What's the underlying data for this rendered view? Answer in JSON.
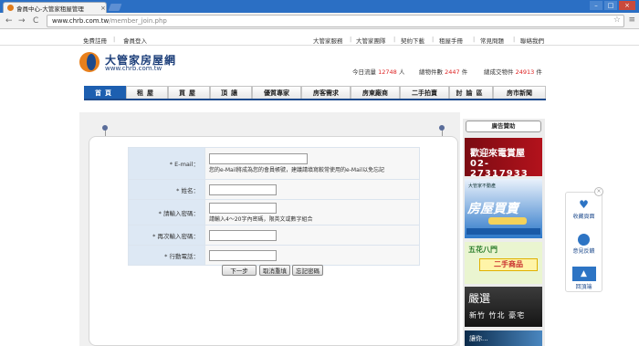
{
  "browser": {
    "tab_title": "會員中心-大管家租屋管理",
    "tab_close": "×",
    "url_host": "www.chrb.com.tw",
    "url_path": "/member_join.php",
    "back": "←",
    "forward": "→",
    "reload": "C",
    "star": "☆",
    "menu": "≡"
  },
  "top_links": {
    "left": [
      "免費註冊",
      "會員登入"
    ],
    "right": [
      "大管家服務",
      "大管家團隊",
      "契約下載",
      "租屋手冊",
      "常見問題",
      "聯絡我們"
    ]
  },
  "logo": {
    "name": "大管家房屋網",
    "url": "www.chrb.com.tw"
  },
  "stats": {
    "today_label": "今日流量",
    "today_value": "12748",
    "today_unit": "人",
    "delegated_label": "總物件數",
    "delegated_value": "2447",
    "delegated_unit": "件",
    "done_label": "總成交物件",
    "done_value": "24913",
    "done_unit": "件"
  },
  "main_nav": [
    "首頁",
    "租屋",
    "買屋",
    "頂讓",
    "優質專家",
    "房客需求",
    "房東廠商",
    "二手拍賣",
    "討論區",
    "房市新聞"
  ],
  "form": {
    "rows": [
      {
        "label": "* E-mail：",
        "value": "",
        "hint": "您的e-Mail將成為您的會員帳號，建議請填寫較常使用的e-Mail以免忘記"
      },
      {
        "label": "* 姓名：",
        "value": "",
        "hint": ""
      },
      {
        "label": "* 請輸入密碼：",
        "value": "",
        "hint": "請輸入4～20字內密碼，限英文或數字組合"
      },
      {
        "label": "* 再次輸入密碼：",
        "value": "",
        "hint": ""
      },
      {
        "label": "* 行動電話：",
        "value": "",
        "hint": ""
      }
    ],
    "buttons": {
      "next": "下一步",
      "reset": "取消重填",
      "forgot": "忘記密碼"
    }
  },
  "right_column": {
    "title": "廣告贊助",
    "ad1": {
      "line1": "歡迎來電賞屋",
      "line2": "02-27317933"
    },
    "ad2": {
      "brand": "大管家不動產",
      "title": "房屋買賣"
    },
    "ad3": {
      "line1": "五花八門",
      "line2": "二手商品"
    },
    "ad4": {
      "line1": "嚴選",
      "line2": "新竹 竹北 豪宅"
    },
    "ad5": {
      "line1": "讓你..."
    }
  },
  "float_widget": {
    "close": "×",
    "favorite": "收藏頁面",
    "feedback": "意見反饋",
    "top": "回頂端",
    "top_arrow": "▲"
  },
  "colors": {
    "brand_blue": "#1d4a8c",
    "brand_orange": "#e8801c",
    "stat_red": "#dd2222"
  }
}
